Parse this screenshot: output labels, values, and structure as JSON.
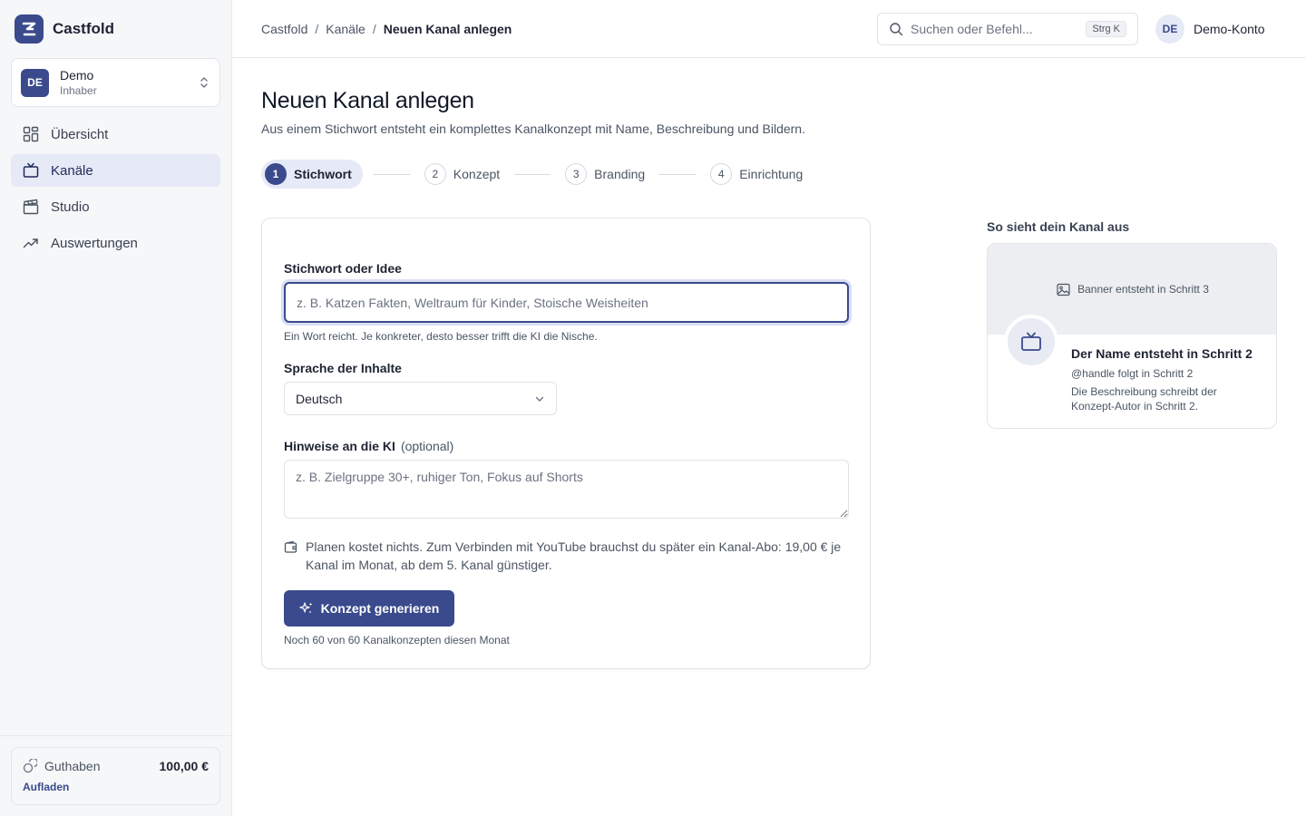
{
  "brand": {
    "name": "Castfold"
  },
  "workspace": {
    "avatar": "DE",
    "name": "Demo",
    "role": "Inhaber"
  },
  "nav": {
    "items": [
      {
        "label": "Übersicht",
        "icon": "grid-icon"
      },
      {
        "label": "Kanäle",
        "icon": "tv-icon",
        "active": true
      },
      {
        "label": "Studio",
        "icon": "clapperboard-icon"
      },
      {
        "label": "Auswertungen",
        "icon": "trend-icon"
      }
    ]
  },
  "credit": {
    "label": "Guthaben",
    "value": "100,00 €",
    "link": "Aufladen"
  },
  "breadcrumb": {
    "root": "Castfold",
    "parent": "Kanäle",
    "current": "Neuen Kanal anlegen",
    "separator": "/"
  },
  "search": {
    "placeholder": "Suchen oder Befehl...",
    "shortcut": "Strg K"
  },
  "account": {
    "avatar": "DE",
    "name": "Demo-Konto"
  },
  "page": {
    "title": "Neuen Kanal anlegen",
    "subtitle": "Aus einem Stichwort entsteht ein komplettes Kanalkonzept mit Name, Beschreibung und Bildern."
  },
  "steps": [
    {
      "num": "1",
      "label": "Stichwort",
      "active": true
    },
    {
      "num": "2",
      "label": "Konzept"
    },
    {
      "num": "3",
      "label": "Branding"
    },
    {
      "num": "4",
      "label": "Einrichtung"
    }
  ],
  "form": {
    "keyword_label": "Stichwort oder Idee",
    "keyword_placeholder": "z. B. Katzen Fakten, Weltraum für Kinder, Stoische Weisheiten",
    "keyword_value": "",
    "keyword_hint": "Ein Wort reicht. Je konkreter, desto besser trifft die KI die Nische.",
    "language_label": "Sprache der Inhalte",
    "language_value": "Deutsch",
    "notes_label": "Hinweise an die KI",
    "notes_optional": "(optional)",
    "notes_placeholder": "z. B. Zielgruppe 30+, ruhiger Ton, Fokus auf Shorts",
    "info_text": "Planen kostet nichts. Zum Verbinden mit YouTube brauchst du später ein Kanal-Abo: 19,00 € je Kanal im Monat, ab dem 5. Kanal günstiger.",
    "cta_label": "Konzept generieren",
    "quota": "Noch 60 von 60 Kanalkonzepten diesen Monat"
  },
  "preview": {
    "title": "So sieht dein Kanal aus",
    "banner_text": "Banner entsteht in Schritt 3",
    "name": "Der Name entsteht in Schritt 2",
    "handle": "@handle folgt in Schritt 2",
    "description": "Die Beschreibung schreibt der Konzept-Autor in Schritt 2."
  },
  "colors": {
    "accent": "#3a4a8c",
    "accent_soft": "#e6e9f6",
    "sidebar_bg": "#f6f7f9"
  }
}
